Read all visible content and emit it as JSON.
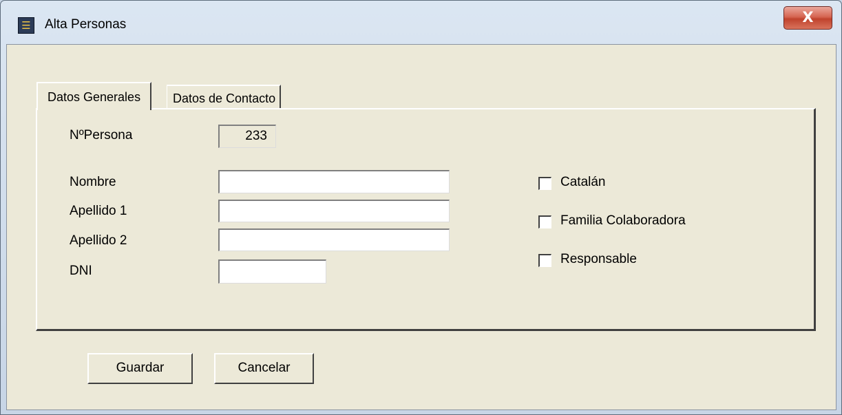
{
  "window": {
    "title": "Alta Personas",
    "close_glyph": "X",
    "icon": "app-icon"
  },
  "tabs": [
    {
      "label": "Datos Generales",
      "active": true
    },
    {
      "label": "Datos de Contacto",
      "active": false
    }
  ],
  "form": {
    "numero_label": "NºPersona",
    "numero_value": "233",
    "nombre_label": "Nombre",
    "nombre_value": "",
    "apellido1_label": "Apellido 1",
    "apellido1_value": "",
    "apellido2_label": "Apellido 2",
    "apellido2_value": "",
    "dni_label": "DNI",
    "dni_value": ""
  },
  "checkboxes": [
    {
      "label": "Catalán",
      "checked": false
    },
    {
      "label": "Familia Colaboradora",
      "checked": false
    },
    {
      "label": "Responsable",
      "checked": false
    }
  ],
  "buttons": {
    "save_label": "Guardar",
    "cancel_label": "Cancelar"
  }
}
